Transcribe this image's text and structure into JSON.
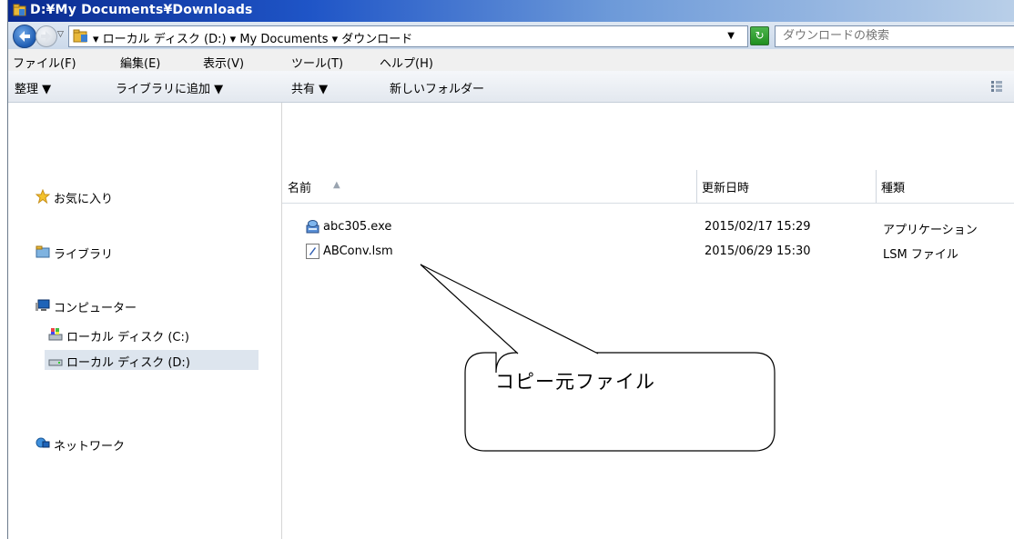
{
  "window": {
    "title": "D:¥My Documents¥Downloads"
  },
  "address": {
    "crumbs": "▾ ローカル ディスク (D:) ▾ My Documents ▾ ダウンロード",
    "search_placeholder": "ダウンロードの検索"
  },
  "menu": {
    "file": "ファイル(F)",
    "edit": "編集(E)",
    "view": "表示(V)",
    "tools": "ツール(T)",
    "help": "ヘルプ(H)"
  },
  "toolbar": {
    "organize": "整理 ▼",
    "add_library": "ライブラリに追加 ▼",
    "share": "共有 ▼",
    "new_folder": "新しいフォルダー"
  },
  "nav": {
    "favorites": "お気に入り",
    "libraries": "ライブラリ",
    "computer": "コンピューター",
    "drive_c": "ローカル ディスク (C:)",
    "drive_d": "ローカル ディスク (D:)",
    "network": "ネットワーク"
  },
  "columns": {
    "name": "名前",
    "modified": "更新日時",
    "type": "種類",
    "sort_indicator": "▲"
  },
  "files": [
    {
      "name": "abc305.exe",
      "modified": "2015/02/17 15:29",
      "type": "アプリケーション",
      "icon": "setup-exe-icon"
    },
    {
      "name": "ABConv.lsm",
      "modified": "2015/06/29 15:30",
      "type": "LSM ファイル",
      "icon": "lsm-file-icon"
    }
  ],
  "callout": {
    "text": "コピー元ファイル"
  },
  "colors": {
    "titlebar_start": "#0a2a8e",
    "selection": "#dde5ee"
  }
}
